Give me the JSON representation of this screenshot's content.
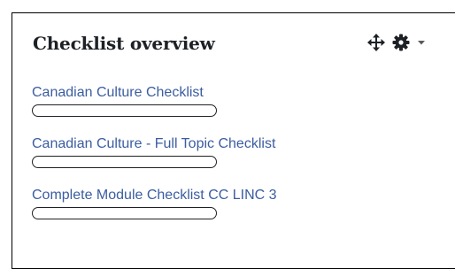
{
  "block": {
    "title": "Checklist overview",
    "move_icon": "move-arrows-icon",
    "settings_icon": "gear-icon",
    "menu_icon": "caret-down-icon"
  },
  "checklists": [
    {
      "name": "Canadian Culture Checklist",
      "progress_percent": 0
    },
    {
      "name": "Canadian Culture - Full Topic Checklist",
      "progress_percent": 0
    },
    {
      "name": "Complete Module Checklist CC LINC 3",
      "progress_percent": 0
    }
  ],
  "colors": {
    "link": "#3b5da0",
    "title": "#1d2125",
    "border": "#000000"
  }
}
